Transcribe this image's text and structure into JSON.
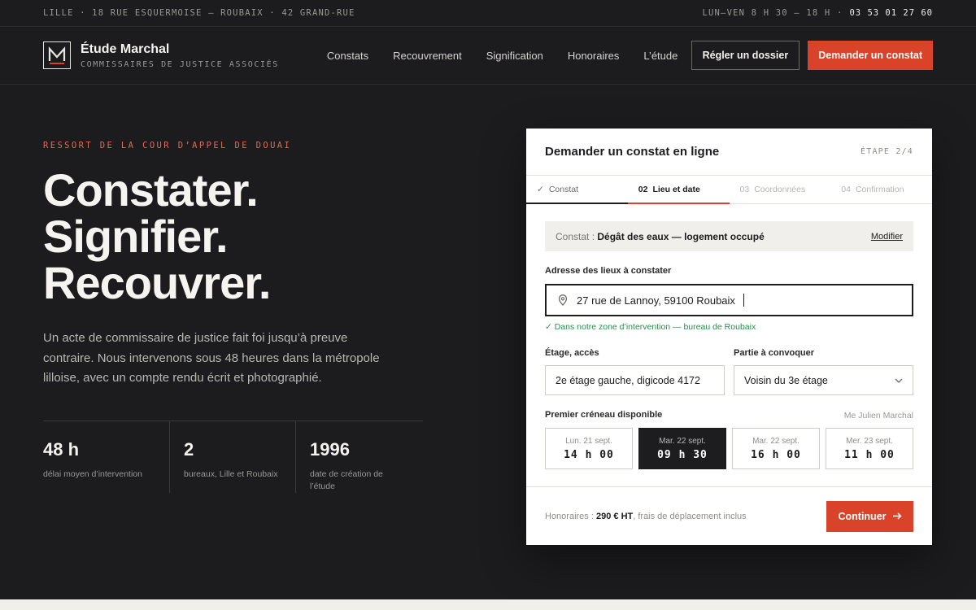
{
  "topbar": {
    "address": "LILLE · 18 RUE ESQUERMOISE — ROUBAIX · 42 GRAND-RUE",
    "hours": "LUN–VEN 8 H 30 – 18 H ·",
    "phone": "03 53 01 27 60"
  },
  "brand": {
    "name": "Étude Marchal",
    "subtitle": "COMMISSAIRES DE JUSTICE ASSOCIÉS"
  },
  "nav": {
    "links": [
      "Constats",
      "Recouvrement",
      "Signification",
      "Honoraires",
      "L’étude"
    ],
    "pay_button": "Régler un dossier",
    "cta_button": "Demander un constat"
  },
  "hero": {
    "kicker": "RESSORT DE LA COUR D’APPEL DE DOUAI",
    "title_lines": [
      "Constater.",
      "Signifier.",
      "Recouvrer."
    ],
    "description": "Un acte de commissaire de justice fait foi jusqu’à preuve contraire. Nous intervenons sous 48 heures dans la métropole lilloise, avec un compte rendu écrit et photographié."
  },
  "stats": [
    {
      "value": "48 h",
      "label": "délai moyen d’intervention"
    },
    {
      "value": "2",
      "label": "bureaux, Lille et Roubaix"
    },
    {
      "value": "1996",
      "label": "date de création de l’étude"
    }
  ],
  "form": {
    "title": "Demander un constat en ligne",
    "step": "ÉTAPE 2/4",
    "tabs": [
      {
        "num": "✓",
        "label": "Constat",
        "state": "done"
      },
      {
        "num": "02",
        "label": "Lieu et date",
        "state": "active"
      },
      {
        "num": "03",
        "label": "Coordonnées",
        "state": "todo"
      },
      {
        "num": "04",
        "label": "Confirmation",
        "state": "todo"
      }
    ],
    "summary_key": "Constat :",
    "summary_value": "Dégât des eaux — logement occupé",
    "summary_modify": "Modifier",
    "address_label": "Adresse des lieux à constater",
    "address_value": "27 rue de Lannoy, 59100 Roubaix",
    "address_ok": "✓ Dans notre zone d’intervention — bureau de Roubaix",
    "floor_label": "Étage, accès",
    "floor_value": "2e étage gauche, digicode 4172",
    "party_label": "Partie à convoquer",
    "party_value": "Voisin du 3e étage",
    "slots_label": "Premier créneau disponible",
    "slots_who": "Me Julien Marchal",
    "slots": [
      {
        "day": "Lun. 21 sept.",
        "time": "14 h 00",
        "selected": false
      },
      {
        "day": "Mar. 22 sept.",
        "time": "09 h 30",
        "selected": true
      },
      {
        "day": "Mar. 22 sept.",
        "time": "16 h 00",
        "selected": false
      },
      {
        "day": "Mer. 23 sept.",
        "time": "11 h 00",
        "selected": false
      }
    ],
    "fees_prefix": "Honoraires :",
    "fees_amount": "290 € HT",
    "fees_suffix": ", frais de déplacement inclus",
    "continue_label": "Continuer"
  },
  "colors": {
    "accent": "#d9432a",
    "background": "#1c1c1e",
    "success": "#2f8a4e"
  }
}
